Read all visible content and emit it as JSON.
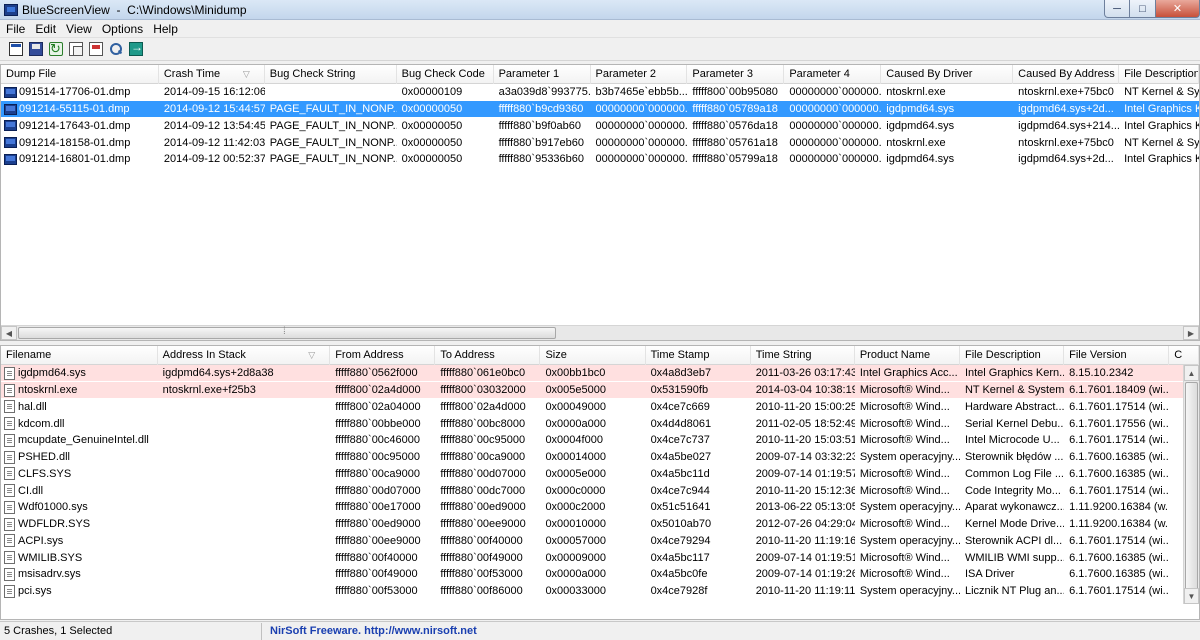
{
  "window": {
    "title": "BlueScreenView  -  C:\\Windows\\Minidump",
    "icon": "bluescreen-app-icon",
    "min": "─",
    "max": "□",
    "close": "✕"
  },
  "menu": [
    "File",
    "Edit",
    "View",
    "Options",
    "Help"
  ],
  "toolbar": [
    "properties-icon",
    "save-icon",
    "refresh-icon",
    "copy-icon",
    "html-report-icon",
    "find-icon",
    "exit-icon"
  ],
  "crash_list": {
    "columns": [
      "Dump File",
      "Crash Time",
      "Bug Check String",
      "Bug Check Code",
      "Parameter 1",
      "Parameter 2",
      "Parameter 3",
      "Parameter 4",
      "Caused By Driver",
      "Caused By Address",
      "File Description"
    ],
    "sort_column": 1,
    "rows": [
      {
        "cells": [
          "091514-17706-01.dmp",
          "2014-09-15 16:12:06",
          "",
          "0x00000109",
          "a3a039d8`993775...",
          "b3b7465e`ebb5b...",
          "fffff800`00b95080",
          "00000000`000000...",
          "ntoskrnl.exe",
          "ntoskrnl.exe+75bc0",
          "NT Kernel & System"
        ],
        "selected": false
      },
      {
        "cells": [
          "091214-55115-01.dmp",
          "2014-09-12 15:44:57",
          "PAGE_FAULT_IN_NONP...",
          "0x00000050",
          "fffff880`b9cd9360",
          "00000000`000000...",
          "fffff880`05789a18",
          "00000000`000000...",
          "igdpmd64.sys",
          "igdpmd64.sys+2d...",
          "Intel Graphics Kernel"
        ],
        "selected": true
      },
      {
        "cells": [
          "091214-17643-01.dmp",
          "2014-09-12 13:54:45",
          "PAGE_FAULT_IN_NONP...",
          "0x00000050",
          "fffff880`b9f0ab60",
          "00000000`000000...",
          "fffff880`0576da18",
          "00000000`000000...",
          "igdpmd64.sys",
          "igdpmd64.sys+214...",
          "Intel Graphics Kernel"
        ],
        "selected": false
      },
      {
        "cells": [
          "091214-18158-01.dmp",
          "2014-09-12 11:42:03",
          "PAGE_FAULT_IN_NONP...",
          "0x00000050",
          "fffff880`b917eb60",
          "00000000`000000...",
          "fffff880`05761a18",
          "00000000`000000...",
          "ntoskrnl.exe",
          "ntoskrnl.exe+75bc0",
          "NT Kernel & System"
        ],
        "selected": false
      },
      {
        "cells": [
          "091214-16801-01.dmp",
          "2014-09-12 00:52:37",
          "PAGE_FAULT_IN_NONP...",
          "0x00000050",
          "fffff880`95336b60",
          "00000000`000000...",
          "fffff880`05799a18",
          "00000000`000000...",
          "igdpmd64.sys",
          "igdpmd64.sys+2d...",
          "Intel Graphics Kernel"
        ],
        "selected": false
      }
    ]
  },
  "driver_list": {
    "columns": [
      "Filename",
      "Address In Stack",
      "From Address",
      "To Address",
      "Size",
      "Time Stamp",
      "Time String",
      "Product Name",
      "File Description",
      "File Version",
      "C"
    ],
    "sort_column": 1,
    "rows": [
      {
        "cells": [
          "igdpmd64.sys",
          "igdpmd64.sys+2d8a38",
          "fffff880`0562f000",
          "fffff880`061e0bc0",
          "0x00bb1bc0",
          "0x4a8d3eb7",
          "2011-03-26 03:17:43",
          "Intel Graphics Acc...",
          "Intel Graphics Kern...",
          "8.15.10.2342",
          ""
        ],
        "highlight": true
      },
      {
        "cells": [
          "ntoskrnl.exe",
          "ntoskrnl.exe+f25b3",
          "fffff800`02a4d000",
          "fffff800`03032000",
          "0x005e5000",
          "0x531590fb",
          "2014-03-04 10:38:19",
          "Microsoft® Wind...",
          "NT Kernel & System",
          "6.1.7601.18409 (wi...",
          ""
        ],
        "highlight": true
      },
      {
        "cells": [
          "hal.dll",
          "",
          "fffff800`02a04000",
          "fffff800`02a4d000",
          "0x00049000",
          "0x4ce7c669",
          "2010-11-20 15:00:25",
          "Microsoft® Wind...",
          "Hardware Abstract...",
          "6.1.7601.17514 (wi...",
          ""
        ],
        "highlight": false
      },
      {
        "cells": [
          "kdcom.dll",
          "",
          "fffff880`00bbe000",
          "fffff880`00bc8000",
          "0x0000a000",
          "0x4d4d8061",
          "2011-02-05 18:52:49",
          "Microsoft® Wind...",
          "Serial Kernel Debu...",
          "6.1.7601.17556 (wi...",
          ""
        ],
        "highlight": false
      },
      {
        "cells": [
          "mcupdate_GenuineIntel.dll",
          "",
          "fffff880`00c46000",
          "fffff880`00c95000",
          "0x0004f000",
          "0x4ce7c737",
          "2010-11-20 15:03:51",
          "Microsoft® Wind...",
          "Intel Microcode U...",
          "6.1.7601.17514 (wi...",
          ""
        ],
        "highlight": false
      },
      {
        "cells": [
          "PSHED.dll",
          "",
          "fffff880`00c95000",
          "fffff880`00ca9000",
          "0x00014000",
          "0x4a5be027",
          "2009-07-14 03:32:23",
          "System operacyjny...",
          "Sterownik błędów ...",
          "6.1.7600.16385 (wi...",
          ""
        ],
        "highlight": false
      },
      {
        "cells": [
          "CLFS.SYS",
          "",
          "fffff880`00ca9000",
          "fffff880`00d07000",
          "0x0005e000",
          "0x4a5bc11d",
          "2009-07-14 01:19:57",
          "Microsoft® Wind...",
          "Common Log File ...",
          "6.1.7600.16385 (wi...",
          ""
        ],
        "highlight": false
      },
      {
        "cells": [
          "CI.dll",
          "",
          "fffff880`00d07000",
          "fffff880`00dc7000",
          "0x000c0000",
          "0x4ce7c944",
          "2010-11-20 15:12:36",
          "Microsoft® Wind...",
          "Code Integrity Mo...",
          "6.1.7601.17514 (wi...",
          ""
        ],
        "highlight": false
      },
      {
        "cells": [
          "Wdf01000.sys",
          "",
          "fffff880`00e17000",
          "fffff880`00ed9000",
          "0x000c2000",
          "0x51c51641",
          "2013-06-22 05:13:05",
          "System operacyjny...",
          "Aparat wykonawcz...",
          "1.11.9200.16384 (w...",
          ""
        ],
        "highlight": false
      },
      {
        "cells": [
          "WDFLDR.SYS",
          "",
          "fffff880`00ed9000",
          "fffff880`00ee9000",
          "0x00010000",
          "0x5010ab70",
          "2012-07-26 04:29:04",
          "Microsoft® Wind...",
          "Kernel Mode Drive...",
          "1.11.9200.16384 (w...",
          ""
        ],
        "highlight": false
      },
      {
        "cells": [
          "ACPI.sys",
          "",
          "fffff880`00ee9000",
          "fffff880`00f40000",
          "0x00057000",
          "0x4ce79294",
          "2010-11-20 11:19:16",
          "System operacyjny...",
          "Sterownik ACPI dl...",
          "6.1.7601.17514 (wi...",
          ""
        ],
        "highlight": false
      },
      {
        "cells": [
          "WMILIB.SYS",
          "",
          "fffff880`00f40000",
          "fffff880`00f49000",
          "0x00009000",
          "0x4a5bc117",
          "2009-07-14 01:19:51",
          "Microsoft® Wind...",
          "WMILIB WMI supp...",
          "6.1.7600.16385 (wi...",
          ""
        ],
        "highlight": false
      },
      {
        "cells": [
          "msisadrv.sys",
          "",
          "fffff880`00f49000",
          "fffff880`00f53000",
          "0x0000a000",
          "0x4a5bc0fe",
          "2009-07-14 01:19:26",
          "Microsoft® Wind...",
          "ISA Driver",
          "6.1.7600.16385 (wi...",
          ""
        ],
        "highlight": false
      },
      {
        "cells": [
          "pci.sys",
          "",
          "fffff880`00f53000",
          "fffff880`00f86000",
          "0x00033000",
          "0x4ce7928f",
          "2010-11-20 11:19:11",
          "System operacyjny...",
          "Licznik NT Plug an...",
          "6.1.7601.17514 (wi...",
          ""
        ],
        "highlight": false
      }
    ]
  },
  "status": {
    "count": "5 Crashes, 1 Selected",
    "link": "NirSoft Freeware.  http://www.nirsoft.net"
  }
}
